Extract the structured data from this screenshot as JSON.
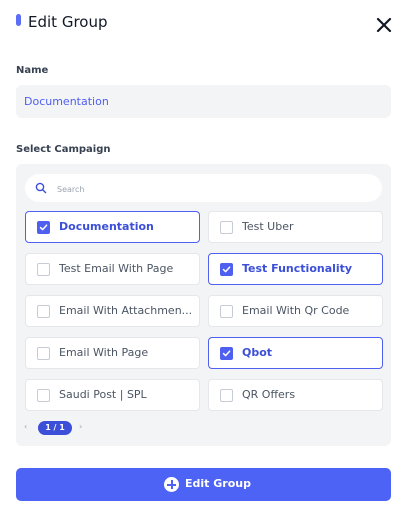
{
  "dialog": {
    "title": "Edit Group",
    "name_label": "Name",
    "name_value": "Documentation",
    "campaign_label": "Select Campaign",
    "search_placeholder": "Search",
    "submit_label": "Edit Group"
  },
  "campaigns": [
    {
      "label": "Documentation",
      "checked": true
    },
    {
      "label": "Test Uber",
      "checked": false
    },
    {
      "label": "Test Email With Page",
      "checked": false
    },
    {
      "label": "Test Functionality",
      "checked": true
    },
    {
      "label": "Email With Attachmen...",
      "checked": false
    },
    {
      "label": "Email With Qr Code",
      "checked": false
    },
    {
      "label": "Email With Page",
      "checked": false
    },
    {
      "label": "Qbot",
      "checked": true
    },
    {
      "label": "Saudi Post | SPL",
      "checked": false
    },
    {
      "label": "QR Offers",
      "checked": false
    }
  ],
  "pagination": {
    "label": "1 / 1",
    "prev": "‹",
    "next": "›"
  },
  "colors": {
    "accent": "#4f5ff0",
    "button": "#4d63f5",
    "panel": "#f3f4f6"
  },
  "icons": {
    "close": "close-icon",
    "search": "search-icon",
    "add": "plus-circle-icon",
    "check": "check-icon"
  }
}
